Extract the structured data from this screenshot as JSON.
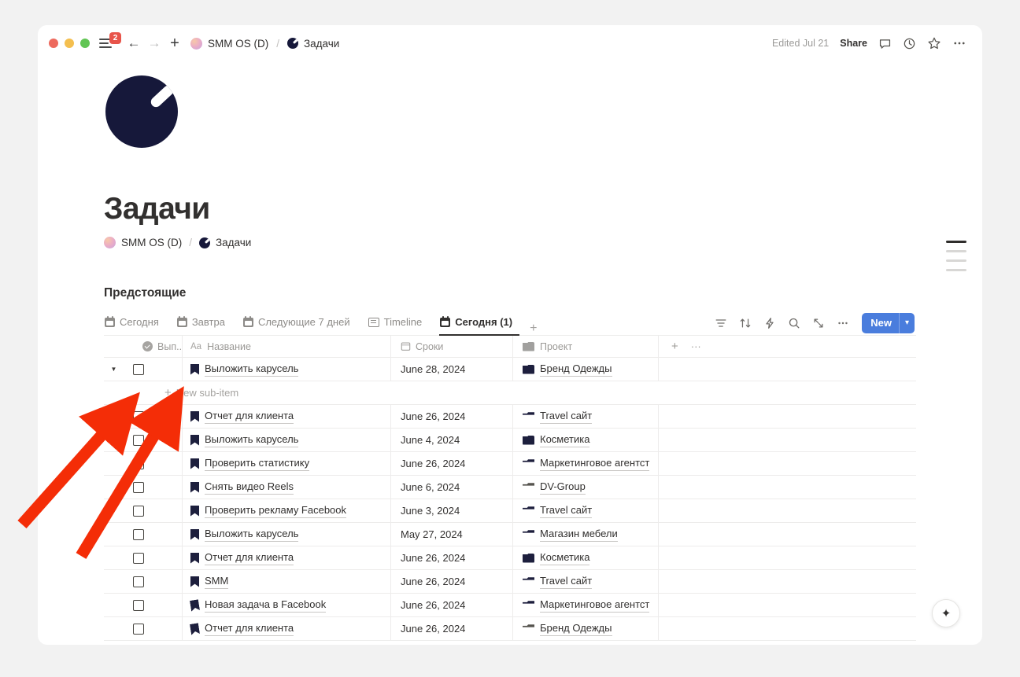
{
  "titlebar": {
    "sidebar_badge": "2",
    "back_icon": "arrow-left-icon",
    "forward_icon": "arrow-right-icon",
    "new_icon": "plus-icon",
    "breadcrumb": [
      {
        "label": "SMM OS (D)",
        "icon": "gradient-orb-icon"
      },
      {
        "label": "Задачи",
        "icon": "moon-icon"
      }
    ],
    "separator": "/",
    "edited": "Edited Jul 21",
    "share": "Share",
    "icons": [
      "comment-icon",
      "history-icon",
      "star-icon",
      "more-icon"
    ]
  },
  "page": {
    "icon": "moon-icon",
    "title": "Задачи",
    "breadcrumb": [
      {
        "label": "SMM OS (D)",
        "icon": "gradient-orb-icon"
      },
      {
        "label": "Задачи",
        "icon": "moon-icon"
      }
    ],
    "separator": "/",
    "section_title": "Предстоящие"
  },
  "tabs": [
    {
      "label": "Сегодня",
      "icon": "calendar-icon",
      "active": false
    },
    {
      "label": "Завтра",
      "icon": "calendar-icon",
      "active": false
    },
    {
      "label": "Следующие 7 дней",
      "icon": "calendar-icon",
      "active": false
    },
    {
      "label": "Timeline",
      "icon": "timeline-icon",
      "active": false
    },
    {
      "label": "Сегодня (1)",
      "icon": "calendar-icon",
      "active": true
    }
  ],
  "tab_add": "+",
  "toolbar": {
    "filter_icon": "filter-icon",
    "sort_icon": "sort-icon",
    "automation_icon": "lightning-icon",
    "search_icon": "search-icon",
    "expand_icon": "expand-icon",
    "more_icon": "more-icon",
    "new_label": "New",
    "new_caret": "chevron-down-icon",
    "accent": "#4a7ddd"
  },
  "table": {
    "columns": [
      {
        "label": "Вып...",
        "icon": "checkbox-circle-icon"
      },
      {
        "label": "Название",
        "icon": "aa-text-icon"
      },
      {
        "label": "Сроки",
        "icon": "date-icon"
      },
      {
        "label": "Проект",
        "icon": "folder-icon"
      }
    ],
    "add_column": "+",
    "more_column": "···",
    "sub_item_label": "New sub-item",
    "sub_item_icon": "plus-icon",
    "rows": [
      {
        "name": "Выложить карусель",
        "date": "June 28, 2024",
        "project": "Бренд Одежды",
        "folder": "closed",
        "folder_color": "dark",
        "expanded": true,
        "underline": true,
        "tilt": false
      },
      {
        "name": "Отчет для клиента",
        "date": "June 26, 2024",
        "project": "Travel сайт",
        "folder": "open",
        "folder_color": "dark",
        "expanded": false,
        "underline": true,
        "tilt": false
      },
      {
        "name": "Выложить карусель",
        "date": "June 4, 2024",
        "project": "Косметика",
        "folder": "closed",
        "folder_color": "dark",
        "expanded": false,
        "underline": true,
        "tilt": false
      },
      {
        "name": "Проверить статистику",
        "date": "June 26, 2024",
        "project": "Маркетинговое агентст",
        "folder": "open",
        "folder_color": "dark",
        "expanded": false,
        "underline": true,
        "tilt": false
      },
      {
        "name": "Снять видео Reels",
        "date": "June 6, 2024",
        "project": "DV-Group",
        "folder": "open",
        "folder_color": "gray",
        "expanded": false,
        "underline": true,
        "tilt": false
      },
      {
        "name": "Проверить рекламу Facebook",
        "date": "June 3, 2024",
        "project": "Travel сайт",
        "folder": "open",
        "folder_color": "dark",
        "expanded": false,
        "underline": true,
        "tilt": false
      },
      {
        "name": "Выложить карусель",
        "date": "May 27, 2024",
        "project": "Магазин мебели",
        "folder": "open",
        "folder_color": "dark",
        "expanded": false,
        "underline": true,
        "tilt": false
      },
      {
        "name": "Отчет для клиента",
        "date": "June 26, 2024",
        "project": "Косметика",
        "folder": "closed",
        "folder_color": "dark",
        "expanded": false,
        "underline": true,
        "tilt": false
      },
      {
        "name": "SMM",
        "date": "June 26, 2024",
        "project": "Travel сайт",
        "folder": "open",
        "folder_color": "dark",
        "expanded": false,
        "underline": true,
        "tilt": false
      },
      {
        "name": "Новая задача в Facebook",
        "date": "June 26, 2024",
        "project": "Маркетинговое агентст",
        "folder": "open",
        "folder_color": "dark",
        "expanded": false,
        "underline": true,
        "tilt": true
      },
      {
        "name": "Отчет для клиента",
        "date": "June 26, 2024",
        "project": "Бренд Одежды",
        "folder": "open",
        "folder_color": "gray",
        "expanded": false,
        "underline": true,
        "tilt": true
      }
    ]
  },
  "toc": {
    "items": [
      true,
      false,
      false,
      false
    ]
  },
  "fab": {
    "icon": "sparkle-icon",
    "glyph": "✦"
  },
  "annotation": {
    "arrow_color": "#f42d07",
    "arrow_count": 2
  }
}
